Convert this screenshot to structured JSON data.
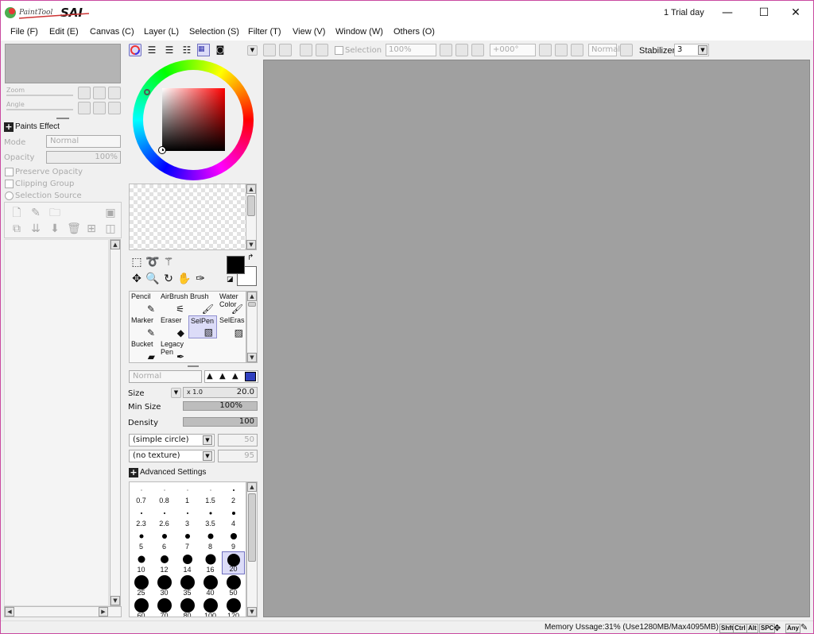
{
  "app": {
    "name": "PaintTool SAI",
    "trial_text": "1 Trial day"
  },
  "window_controls": {
    "minimize": "—",
    "maximize": "☐",
    "close": "✕"
  },
  "menu": [
    "File (F)",
    "Edit (E)",
    "Canvas (C)",
    "Layer (L)",
    "Selection (S)",
    "Filter (T)",
    "View (V)",
    "Window (W)",
    "Others (O)"
  ],
  "navigator": {
    "zoom_label": "Zoom",
    "angle_label": "Angle"
  },
  "layer_panel": {
    "paints_effect": "Paints Effect",
    "mode_label": "Mode",
    "mode_value": "Normal",
    "opacity_label": "Opacity",
    "opacity_value": "100%",
    "preserve_opacity": "Preserve Opacity",
    "clipping_group": "Clipping Group",
    "selection_source": "Selection Source"
  },
  "tools": {
    "brush_tools": [
      {
        "label": "Pencil",
        "icon": "✎"
      },
      {
        "label": "AirBrush",
        "icon": "✈"
      },
      {
        "label": "Brush",
        "icon": "🖌"
      },
      {
        "label": "Water Color",
        "icon": "💧"
      },
      {
        "label": "Marker",
        "icon": "✎"
      },
      {
        "label": "Eraser",
        "icon": "⌫"
      },
      {
        "label": "SelPen",
        "icon": "▦"
      },
      {
        "label": "SelEras",
        "icon": "▦"
      },
      {
        "label": "Bucket",
        "icon": "🪣"
      },
      {
        "label": "Legacy Pen",
        "icon": "✒"
      }
    ],
    "selected": "SelPen"
  },
  "brush_settings": {
    "blend_mode": "Normal",
    "size_label": "Size",
    "size_multiplier": "x 1.0",
    "size_value": "20.0",
    "min_size_label": "Min Size",
    "min_size_value": "100%",
    "density_label": "Density",
    "density_value": "100",
    "shape": "(simple circle)",
    "shape_value": "50",
    "texture": "(no texture)",
    "texture_value": "95",
    "advanced": "Advanced Settings",
    "size_presets": [
      "0.7",
      "0.8",
      "1",
      "1.5",
      "2",
      "2.3",
      "2.6",
      "3",
      "3.5",
      "4",
      "5",
      "6",
      "7",
      "8",
      "9",
      "10",
      "12",
      "14",
      "16",
      "20",
      "25",
      "30",
      "35",
      "40",
      "50",
      "60",
      "70",
      "80",
      "100",
      "120"
    ],
    "selected_preset": "20"
  },
  "toolbar": {
    "selection_label": "Selection",
    "zoom_value": "100%",
    "angle_value": "+000°",
    "blend_value": "Normal",
    "stabilizer_label": "Stabilizer",
    "stabilizer_value": "3"
  },
  "status": {
    "memory": "Memory Ussage:31% (Use1280MB/Max4095MB)",
    "keys": [
      "Shft",
      "Ctrl",
      "Alt",
      "SPC",
      "Any"
    ]
  },
  "colors": {
    "accent_sel": "#dcdcf8",
    "canvas": "#a0a0a0",
    "primary_color": "#000000",
    "secondary_color": "#ffffff",
    "border": "#c94aa0"
  }
}
